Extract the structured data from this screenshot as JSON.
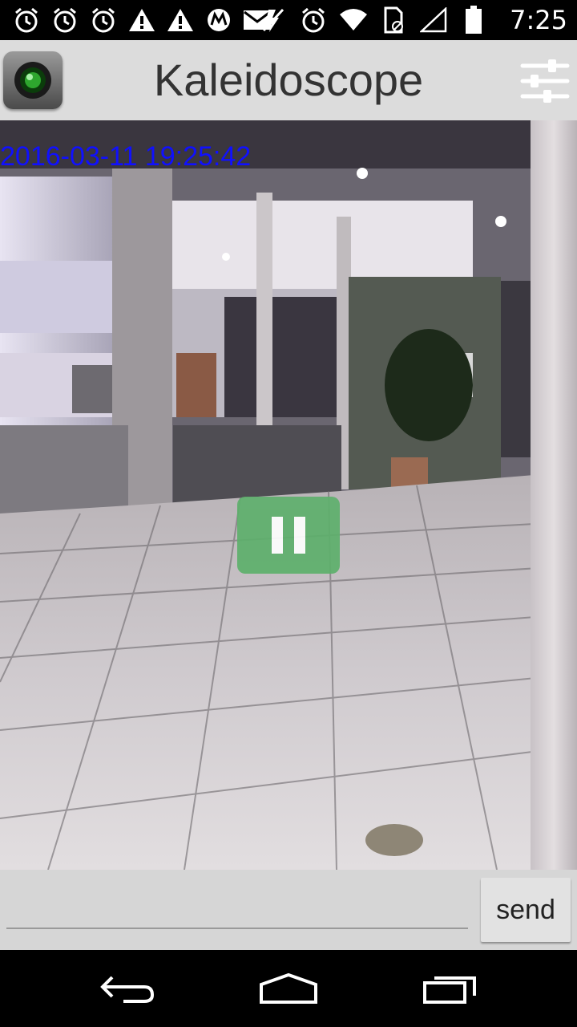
{
  "status_bar": {
    "time": "7:25",
    "left_icons": [
      "alarm-icon",
      "alarm-icon",
      "alarm-icon",
      "warning-icon",
      "warning-icon",
      "motorola-icon",
      "mail-icon"
    ],
    "right_icons": [
      "mute-icon",
      "alarm-icon",
      "wifi-icon",
      "sim-icon",
      "signal-icon",
      "battery-icon"
    ]
  },
  "action_bar": {
    "title": "Kaleidoscope",
    "app_icon": "camera-lens-icon",
    "settings_icon": "sliders-icon"
  },
  "camera": {
    "timestamp": "2016-03-11 19:25:42",
    "timestamp_color": "#1010ff",
    "pause_color": "#5eb06c",
    "pause_icon": "pause-icon"
  },
  "message_bar": {
    "input_value": "",
    "input_placeholder": "",
    "send_label": "send"
  },
  "nav_bar": {
    "icons": [
      "back-icon",
      "home-icon",
      "recents-icon"
    ]
  }
}
